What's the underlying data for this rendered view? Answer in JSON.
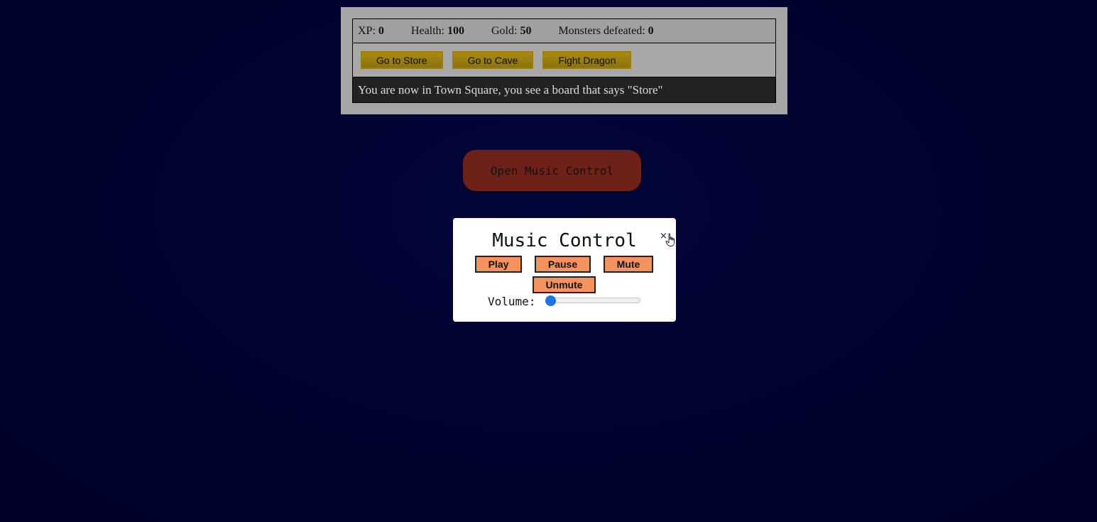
{
  "stats": {
    "xp_label": "XP:",
    "xp_value": "0",
    "health_label": "Health:",
    "health_value": "100",
    "gold_label": "Gold:",
    "gold_value": "50",
    "monsters_label": "Monsters defeated:",
    "monsters_value": "0"
  },
  "controls": {
    "button1": "Go to Store",
    "button2": "Go to Cave",
    "button3": "Fight Dragon"
  },
  "text": "You are now in Town Square, you see a board that says \"Store\"",
  "open_music_button": "Open Music Control",
  "music_control": {
    "title": "Music Control",
    "close": "×",
    "play": "Play",
    "pause": "Pause",
    "mute": "Mute",
    "unmute": "Unmute",
    "volume_label": "Volume:",
    "volume_level": 0
  },
  "colors": {
    "background": "#01022e",
    "game_button": "#b3920f",
    "music_button": "#f5935e",
    "open_music_button": "#6e2116",
    "slider_accent": "#1b74e8"
  }
}
